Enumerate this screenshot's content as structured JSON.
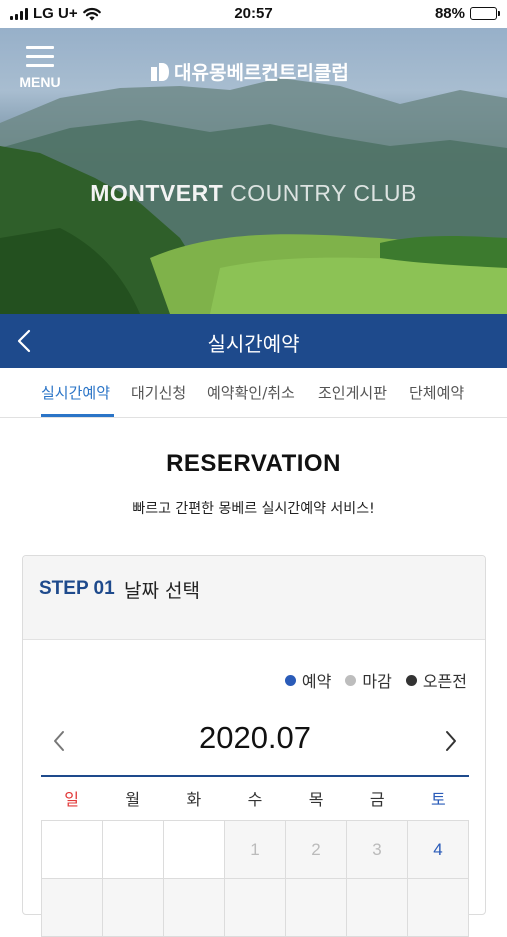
{
  "status_bar": {
    "carrier": "LG U+",
    "time": "20:57",
    "battery": "88%",
    "battery_level": 0.88
  },
  "header": {
    "menu_label": "MENU",
    "logo_text": "대유몽베르컨트리클럽",
    "hero_title_bold": "MONTVERT",
    "hero_title_light": "COUNTRY CLUB"
  },
  "titlebar": {
    "title": "실시간예약",
    "back_icon": "chevron-left-icon"
  },
  "tabs": [
    {
      "label": "실시간예약",
      "active": true
    },
    {
      "label": "대기신청",
      "active": false
    },
    {
      "label": "예약확인/취소",
      "active": false
    },
    {
      "label": "조인게시판",
      "active": false
    },
    {
      "label": "단체예약",
      "active": false
    }
  ],
  "main": {
    "title": "RESERVATION",
    "subtitle": "빠르고 간편한 몽베르 실시간예약 서비스!"
  },
  "step": {
    "label": "STEP 01",
    "text": "날짜 선택"
  },
  "legend": [
    {
      "label": "예약",
      "color": "#2a5bb8"
    },
    {
      "label": "마감",
      "color": "#bdbdbd"
    },
    {
      "label": "오픈전",
      "color": "#333333"
    }
  ],
  "calendar": {
    "month": "2020.07",
    "weekdays": [
      "일",
      "월",
      "화",
      "수",
      "목",
      "금",
      "토"
    ],
    "first_row": [
      "",
      "",
      "",
      "1",
      "2",
      "3",
      "4"
    ]
  },
  "colors": {
    "primary": "#1e4a8c",
    "accent": "#2a74c7",
    "sunday": "#e23a3a",
    "saturday": "#2a5bb8"
  }
}
